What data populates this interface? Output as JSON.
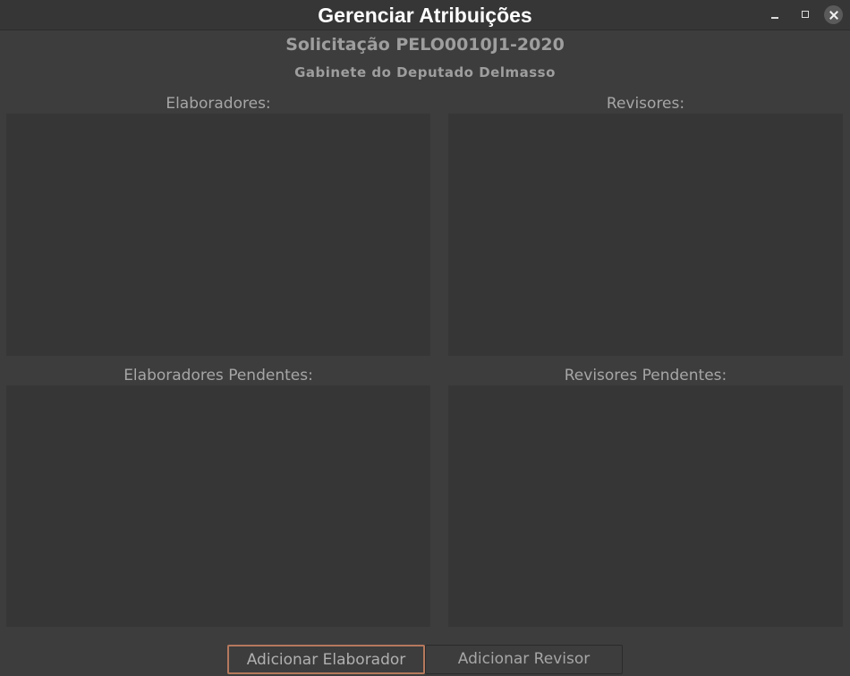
{
  "window": {
    "title": "Gerenciar Atribuições",
    "controls": {
      "minimize": "minimize-icon",
      "maximize": "maximize-icon",
      "close": "close-icon"
    }
  },
  "header": {
    "request": "Solicitação PELO0010J1-2020",
    "office": "Gabinete do Deputado Delmasso"
  },
  "panels": {
    "elaboradores": "Elaboradores:",
    "revisores": "Revisores:",
    "elaboradores_pendentes": "Elaboradores Pendentes:",
    "revisores_pendentes": "Revisores Pendentes:"
  },
  "buttons": {
    "add_elaborador": "Adicionar Elaborador",
    "add_revisor": "Adicionar Revisor"
  },
  "colors": {
    "focus_border": "#b5795d",
    "background": "#3d3d3d",
    "panel": "#363636"
  }
}
